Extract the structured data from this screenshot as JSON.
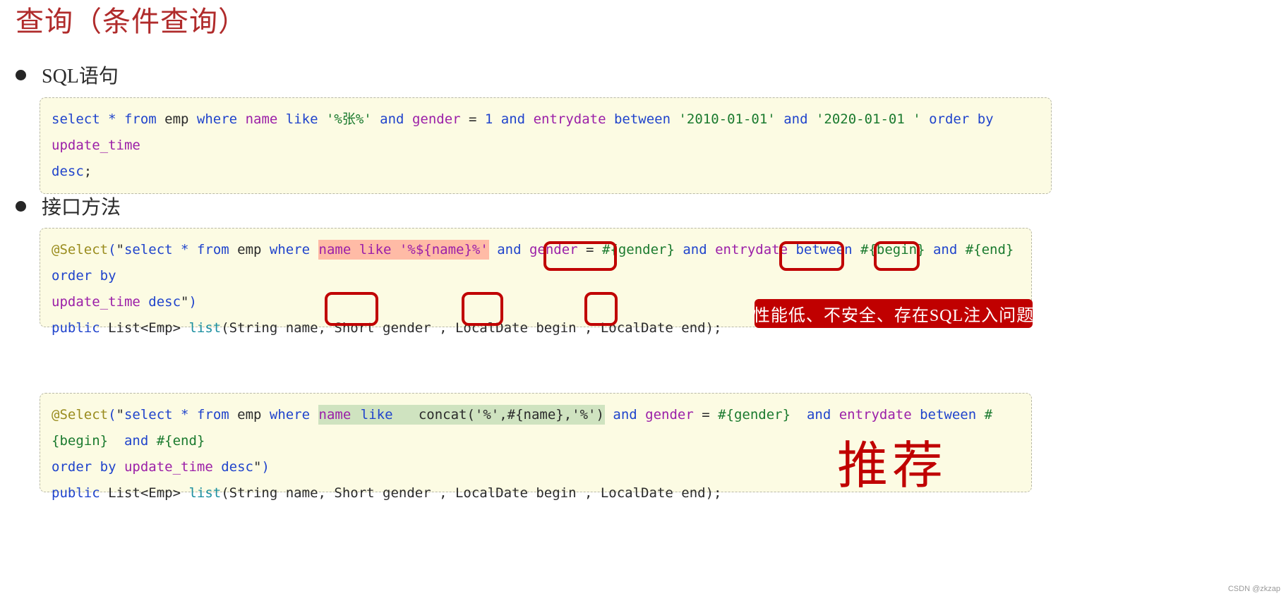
{
  "page": {
    "title": "查询（条件查询）",
    "title_color": "#b02b2b",
    "background": "#ffffff",
    "watermark": "CSDN @zkzap"
  },
  "sections": [
    {
      "bullet": "●",
      "label": "SQL语句"
    },
    {
      "bullet": "●",
      "label": "接口方法"
    }
  ],
  "code_blocks": {
    "sql": {
      "line1": {
        "t1": "select * ",
        "t2": "from ",
        "t3": "emp ",
        "t4": "where ",
        "t5": "name ",
        "t6": "like ",
        "t7": "'%张%' ",
        "t8": "and ",
        "t9": "gender ",
        "t10": "= ",
        "t11": "1 ",
        "t12": "and ",
        "t13": "entrydate ",
        "t14": "between ",
        "t15": "'2010-01-01' ",
        "t16": "and ",
        "t17": "'2020-01-01 ' ",
        "t18": "order by ",
        "t19": "update_time"
      },
      "line2": {
        "t1": "desc",
        "t2": ";"
      }
    },
    "mapper_bad": {
      "line1": {
        "a1": "@Select",
        "a2": "(",
        "a3": "\"",
        "a4": "select * ",
        "a5": "from ",
        "a6": "emp ",
        "a7": "where ",
        "hl1": "name like '%${name}%'",
        "a8": " and ",
        "a9": "gender ",
        "a10": "= ",
        "box1": "#{gender}",
        "a11": " and ",
        "a12": "entrydate ",
        "a13": "between ",
        "box2": "#{begin}",
        "a14": " and ",
        "box3": "#{end}",
        "a15": " order by"
      },
      "line2": {
        "b1": "update_time ",
        "b2": "desc",
        "b3": "\"",
        "b4": ")"
      },
      "line3": {
        "c1": "public ",
        "c2": "List<Emp> ",
        "c3": "list",
        "c4": "(String name, Short gender , LocalDate begin , LocalDate end);"
      },
      "warning_banner": "性能低、不安全、存在SQL注入问题",
      "warning_color": "#c00000",
      "highlight_color": "#ffbba6",
      "box_color": "#c00000"
    },
    "mapper_good": {
      "line1": {
        "a1": "@Select",
        "a2": "(",
        "a3": "\"",
        "a4": "select * ",
        "a5": "from ",
        "a6": "emp ",
        "a7": "where ",
        "hl_name": "name ",
        "hl_like": "like ",
        "hl_concat": "  concat('%',#{name},'%')",
        "a8": " and ",
        "a9": "gender ",
        "a10": "= ",
        "a11": "#{gender} ",
        "a12": " and ",
        "a13": "entrydate ",
        "a14": "between ",
        "a15": "#{begin} ",
        "a16": " and ",
        "a17": "#{end}"
      },
      "line2": {
        "b1": "order by ",
        "b2": "update_time ",
        "b3": "desc",
        "b4": "\"",
        "b5": ")"
      },
      "line3": {
        "c1": "public ",
        "c2": "List<Emp> ",
        "c3": "list",
        "c4": "(String name, Short gender , LocalDate begin , LocalDate end);"
      },
      "recommend_label": "推荐",
      "recommend_color": "#c00000",
      "highlight_color": "#cfe3c0"
    }
  }
}
